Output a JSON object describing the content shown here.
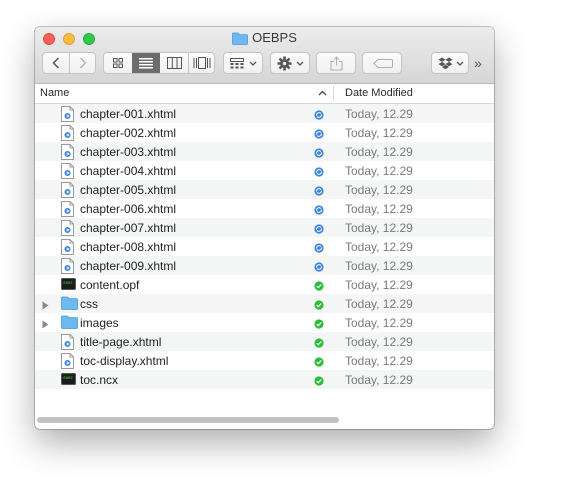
{
  "window": {
    "title": "OEBPS"
  },
  "toolbar": {
    "back_icon": "chevron-left-icon",
    "forward_icon": "chevron-right-icon",
    "view_modes": [
      "icon-view-icon",
      "list-view-icon",
      "column-view-icon",
      "cover-flow-icon"
    ],
    "active_view": "list-view-icon",
    "group_icon": "group-by-icon",
    "action_icon": "gear-icon",
    "share_icon": "share-icon",
    "tags_icon": "tag-icon",
    "dropbox_icon": "dropbox-icon",
    "overflow": "»"
  },
  "columns": {
    "name": "Name",
    "date_modified": "Date Modified",
    "sort_indicator": "^"
  },
  "files": [
    {
      "name": "chapter-001.xhtml",
      "kind": "xhtml",
      "status": "syncing",
      "date": "Today, 12.29"
    },
    {
      "name": "chapter-002.xhtml",
      "kind": "xhtml",
      "status": "syncing",
      "date": "Today, 12.29"
    },
    {
      "name": "chapter-003.xhtml",
      "kind": "xhtml",
      "status": "syncing",
      "date": "Today, 12.29"
    },
    {
      "name": "chapter-004.xhtml",
      "kind": "xhtml",
      "status": "syncing",
      "date": "Today, 12.29"
    },
    {
      "name": "chapter-005.xhtml",
      "kind": "xhtml",
      "status": "syncing",
      "date": "Today, 12.29"
    },
    {
      "name": "chapter-006.xhtml",
      "kind": "xhtml",
      "status": "syncing",
      "date": "Today, 12.29"
    },
    {
      "name": "chapter-007.xhtml",
      "kind": "xhtml",
      "status": "syncing",
      "date": "Today, 12.29"
    },
    {
      "name": "chapter-008.xhtml",
      "kind": "xhtml",
      "status": "syncing",
      "date": "Today, 12.29"
    },
    {
      "name": "chapter-009.xhtml",
      "kind": "xhtml",
      "status": "syncing",
      "date": "Today, 12.29"
    },
    {
      "name": "content.opf",
      "kind": "exec",
      "status": "synced",
      "date": "Today, 12.29"
    },
    {
      "name": "css",
      "kind": "folder",
      "status": "synced",
      "date": "Today, 12.29"
    },
    {
      "name": "images",
      "kind": "folder",
      "status": "synced",
      "date": "Today, 12.29"
    },
    {
      "name": "title-page.xhtml",
      "kind": "xhtml",
      "status": "synced",
      "date": "Today, 12.29"
    },
    {
      "name": "toc-display.xhtml",
      "kind": "xhtml",
      "status": "synced",
      "date": "Today, 12.29"
    },
    {
      "name": "toc.ncx",
      "kind": "exec",
      "status": "synced",
      "date": "Today, 12.29"
    }
  ],
  "colors": {
    "syncing": "#3a86d8",
    "synced": "#2dbd3a",
    "folder": "#6cb9f0",
    "accent": "#6d6d6d"
  }
}
